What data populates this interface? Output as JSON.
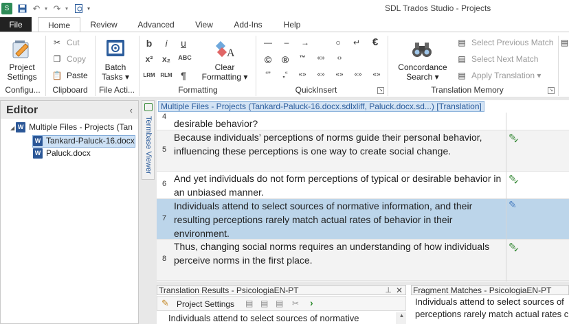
{
  "app": {
    "title": "SDL Trados Studio - Projects"
  },
  "qat": {
    "save_icon": "floppy-disk-icon",
    "undo_icon": "undo-icon",
    "redo_icon": "redo-icon",
    "customize_icon": "dropdown-icon"
  },
  "tabs": [
    "File",
    "Home",
    "Review",
    "Advanced",
    "View",
    "Add-Ins",
    "Help"
  ],
  "ribbon": {
    "configuration": {
      "label1": "Project",
      "label2": "Settings",
      "group": "Configu..."
    },
    "clipboard": {
      "cut": "Cut",
      "copy": "Copy",
      "paste": "Paste",
      "group": "Clipboard"
    },
    "file_actions": {
      "label1": "Batch",
      "label2": "Tasks ▾",
      "group": "File Acti..."
    },
    "formatting": {
      "clear1": "Clear",
      "clear2": "Formatting ▾",
      "group": "Formatting",
      "icons": [
        "b",
        "i",
        "u",
        "x²",
        "x₂",
        "ABC",
        "LRM",
        "RLM",
        "¶"
      ]
    },
    "quickinsert": {
      "group": "QuickInsert",
      "symbols": [
        "—",
        "–",
        "→",
        "○",
        "↵",
        "€",
        "©",
        "®",
        "™",
        "«»",
        "‹›",
        "“”",
        "„“",
        "«»",
        "«»",
        "«»",
        "«»",
        "«»"
      ]
    },
    "tm": {
      "concordance1": "Concordance",
      "concordance2": "Search ▾",
      "prev": "Select Previous Match",
      "next": "Select Next Match",
      "apply": "Apply Translation ▾",
      "group": "Translation Memory"
    }
  },
  "editor": {
    "title": "Editor",
    "collapse": "‹",
    "tree": [
      {
        "label": "Multiple Files - Projects (Tan",
        "expander": "◢"
      },
      {
        "label": "Tankard-Paluck-16.docx"
      },
      {
        "label": "Paluck.docx"
      }
    ],
    "doc_icon": "W"
  },
  "termbase": {
    "label": "Termbase Viewer"
  },
  "doc_tab": "Multiple Files - Projects (Tankard-Paluck-16.docx.sdlxliff, Paluck.docx.sd...) [Translation]",
  "segments": [
    {
      "num": "4",
      "text": "desirable behavior?",
      "status": "confirmed"
    },
    {
      "num": "5",
      "text": "Because individuals’ perceptions of norms guide their personal behavior, influencing these perceptions is one way to create social change.",
      "status": "confirmed"
    },
    {
      "num": "6",
      "text": "And yet individuals do not form perceptions of typical or desirable behavior in an unbiased manner.",
      "status": "confirmed"
    },
    {
      "num": "7",
      "text": "Individuals attend to select sources of normative information, and their resulting perceptions rarely match actual rates of behavior in their environment.",
      "status": "editing"
    },
    {
      "num": "8",
      "text": "Thus, changing social norms requires an understanding of how individuals perceive norms in the first place.",
      "status": "confirmed"
    }
  ],
  "status_icons": {
    "confirmed": "green-check-pencil-icon",
    "editing": "pencil-icon"
  },
  "translation_results": {
    "title": "Translation Results - PsicologiaEN-PT",
    "project_settings": "Project Settings",
    "preview": "Individuals attend to select sources of normative"
  },
  "fragment_matches": {
    "title": "Fragment Matches - PsicologiaEN-PT",
    "text": "Individuals attend to select sources of perceptions rarely match actual rates c"
  }
}
